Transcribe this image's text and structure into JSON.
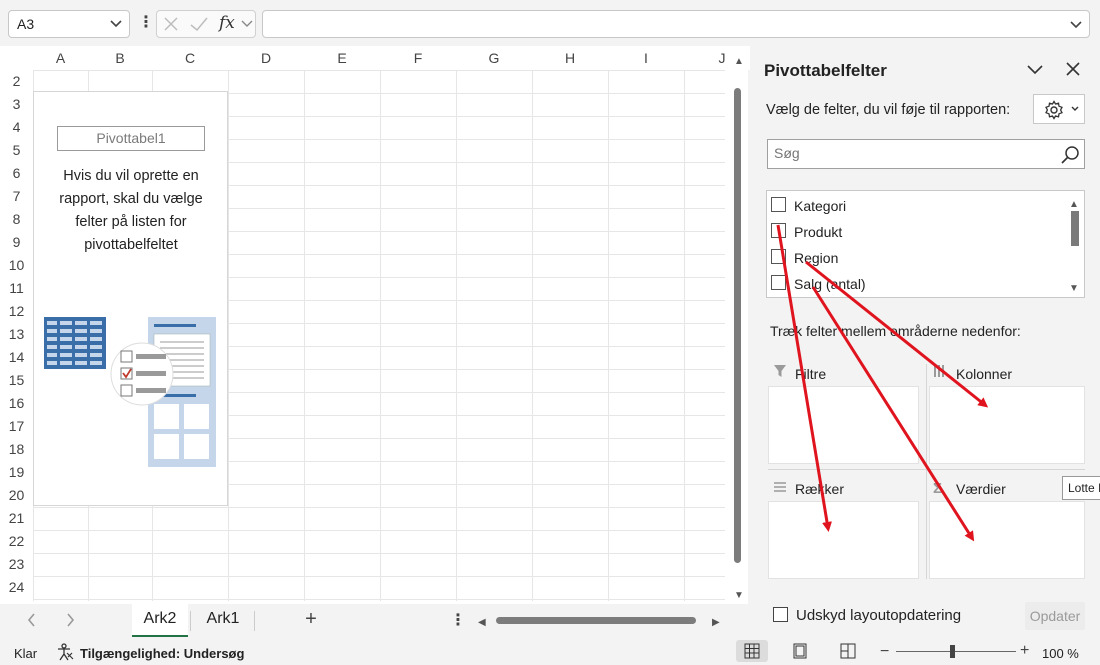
{
  "formula_bar": {
    "name_box": "A3",
    "fx_label": "fx",
    "formula_value": ""
  },
  "columns": [
    "A",
    "B",
    "C",
    "D",
    "E",
    "F",
    "G",
    "H",
    "I",
    "J"
  ],
  "rows": [
    "2",
    "3",
    "4",
    "5",
    "6",
    "7",
    "8",
    "9",
    "10",
    "11",
    "12",
    "13",
    "14",
    "15",
    "16",
    "17",
    "18",
    "19",
    "20",
    "21",
    "22",
    "23",
    "24"
  ],
  "pivot_placeholder": {
    "name": "Pivottabel1",
    "description": "Hvis du vil oprette en rapport, skal du vælge felter på listen for pivottabelfeltet"
  },
  "sheet_tabs": {
    "tabs": [
      {
        "label": "Ark2",
        "active": true
      },
      {
        "label": "Ark1",
        "active": false
      }
    ],
    "add_label": "+"
  },
  "status_bar": {
    "ready": "Klar",
    "accessibility": "Tilgængelighed: Undersøg",
    "zoom": "100 %",
    "zoom_level_percent": 100
  },
  "pivot_pane": {
    "title": "Pivottabelfelter",
    "subtitle": "Vælg de felter, du vil føje til rapporten:",
    "search_placeholder": "Søg",
    "fields": [
      {
        "label": "Kategori",
        "checked": false
      },
      {
        "label": "Produkt",
        "checked": false
      },
      {
        "label": "Region",
        "checked": false
      },
      {
        "label": "Salg (antal)",
        "checked": false
      }
    ],
    "drag_note": "Træk felter mellem områderne nedenfor:",
    "areas": {
      "filters": "Filtre",
      "columns": "Kolonner",
      "rows": "Rækker",
      "values": "Værdier"
    },
    "defer_label": "Udskyd layoutopdatering",
    "update_button": "Opdater",
    "tooltip": "Lotte I"
  },
  "colors": {
    "accent_green": "#217346",
    "arrow_red": "#e0141e",
    "checkbox_red": "#c0392b",
    "illustration_blue": "#3a6ea8",
    "illustration_light": "#c5d6ea"
  }
}
